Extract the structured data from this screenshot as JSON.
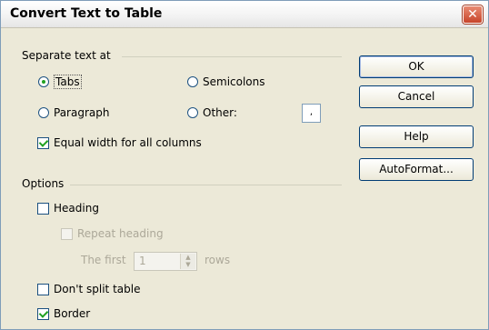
{
  "window": {
    "title": "Convert Text to Table",
    "close_glyph": "✕"
  },
  "separate": {
    "legend": "Separate text at",
    "options": [
      {
        "label": "Tabs",
        "selected": true
      },
      {
        "label": "Semicolons",
        "selected": false
      },
      {
        "label": "Paragraph",
        "selected": false
      },
      {
        "label": "Other:",
        "selected": false
      }
    ],
    "other_value": ",",
    "equal_width": {
      "label": "Equal width for all columns",
      "checked": true
    }
  },
  "options": {
    "legend": "Options",
    "heading": {
      "label": "Heading",
      "checked": false
    },
    "repeat_heading": {
      "label": "Repeat heading",
      "checked": false
    },
    "first_label": "The first",
    "first_value": "1",
    "rows_label": "rows",
    "dont_split": {
      "label": "Don't split table",
      "checked": false
    },
    "border": {
      "label": "Border",
      "checked": true
    }
  },
  "buttons": {
    "ok": "OK",
    "cancel": "Cancel",
    "help": "Help",
    "autoformat": "AutoFormat..."
  },
  "colors": {
    "dialog_bg": "#ECE9D8",
    "check_mark": "#21A121",
    "close_red": "#C7442A"
  }
}
